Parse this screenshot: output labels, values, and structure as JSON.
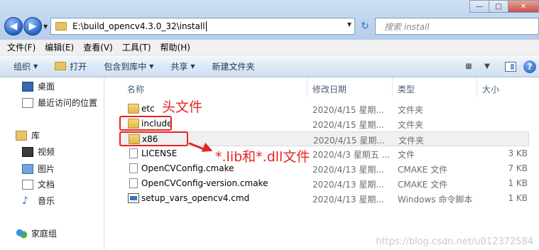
{
  "address": {
    "path": "E:\\build_opencv4.3.0_32\\install"
  },
  "search": {
    "placeholder": "搜索 install"
  },
  "menu": [
    "文件(F)",
    "编辑(E)",
    "查看(V)",
    "工具(T)",
    "帮助(H)"
  ],
  "toolbar": {
    "organize": "组织",
    "open": "打开",
    "include_in_library": "包含到库中",
    "share": "共享",
    "new_folder": "新建文件夹"
  },
  "sidebar": {
    "desktop": "桌面",
    "recent": "最近访问的位置",
    "library": "库",
    "video": "视频",
    "pictures": "图片",
    "documents": "文档",
    "music": "音乐",
    "homegroup": "家庭组"
  },
  "columns": {
    "name": "名称",
    "date": "修改日期",
    "type": "类型",
    "size": "大小"
  },
  "files": [
    {
      "name": "etc",
      "date": "2020/4/15 星期...",
      "type": "文件夹",
      "size": "",
      "icon": "folder-icon"
    },
    {
      "name": "include",
      "date": "2020/4/15 星期...",
      "type": "文件夹",
      "size": "",
      "icon": "folder-icon"
    },
    {
      "name": "x86",
      "date": "2020/4/15 星期...",
      "type": "文件夹",
      "size": "",
      "icon": "folder-icon"
    },
    {
      "name": "LICENSE",
      "date": "2020/4/3 星期五 ...",
      "type": "文件",
      "size": "3 KB",
      "icon": "file-icon"
    },
    {
      "name": "OpenCVConfig.cmake",
      "date": "2020/4/13 星期...",
      "type": "CMAKE 文件",
      "size": "7 KB",
      "icon": "file-icon"
    },
    {
      "name": "OpenCVConfig-version.cmake",
      "date": "2020/4/13 星期...",
      "type": "CMAKE 文件",
      "size": "1 KB",
      "icon": "file-icon"
    },
    {
      "name": "setup_vars_opencv4.cmd",
      "date": "2020/4/13 星期...",
      "type": "Windows 命令脚本",
      "size": "1 KB",
      "icon": "cmd-file-icon"
    }
  ],
  "annotations": {
    "header_files": "头文件",
    "lib_dll": "*.lib和*.dll文件"
  },
  "watermark": "https://blog.csdn.net/u012372584",
  "colors": {
    "annotation": "#e52421",
    "selection": "#f0f0f0"
  }
}
